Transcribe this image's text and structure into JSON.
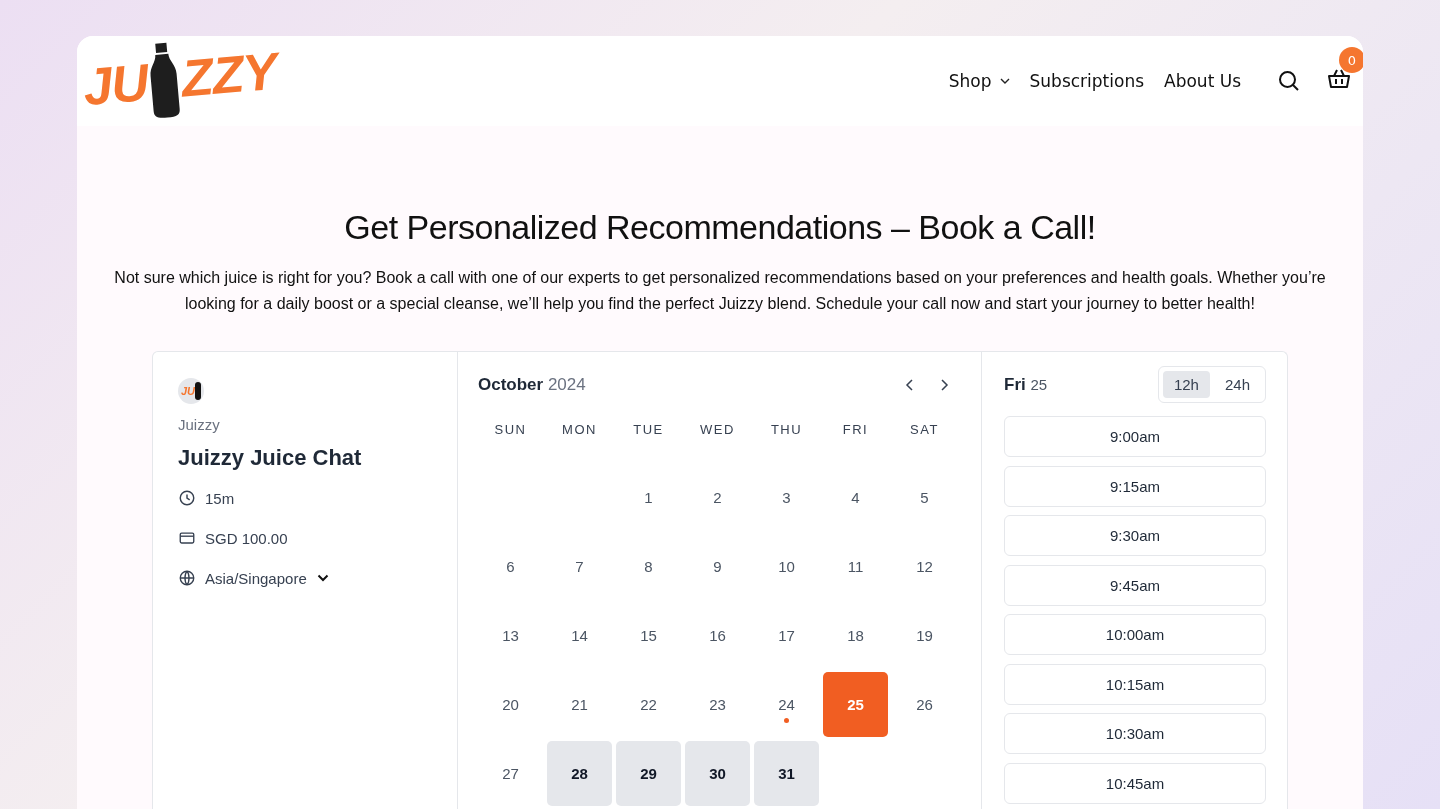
{
  "logo": {
    "left": "JU",
    "right": "ZZY"
  },
  "nav": [
    {
      "label": "Shop",
      "dropdown": true
    },
    {
      "label": "Subscriptions",
      "dropdown": false
    },
    {
      "label": "About Us",
      "dropdown": false
    }
  ],
  "cart": {
    "count": "0"
  },
  "heading": "Get Personalized Recommendations – Book a Call!",
  "intro": "Not sure which juice is right for you? Book a call with one of our experts to get personalized recommendations based on your preferences and health goals. Whether you’re looking for a daily boost or a special cleanse, we’ll help you find the perfect Juizzy blend. Schedule your call now and start your journey to better health!",
  "event": {
    "avatar": "JU",
    "host": "Juizzy",
    "title": "Juizzy Juice Chat",
    "duration": "15m",
    "price": "SGD 100.00",
    "timezone": "Asia/Singapore"
  },
  "calendar": {
    "month": "October",
    "year": "2024",
    "weekdays": [
      "SUN",
      "MON",
      "TUE",
      "WED",
      "THU",
      "FRI",
      "SAT"
    ],
    "days": [
      {
        "kind": "blank"
      },
      {
        "kind": "blank"
      },
      {
        "label": "1",
        "kind": "plain"
      },
      {
        "label": "2",
        "kind": "plain"
      },
      {
        "label": "3",
        "kind": "plain"
      },
      {
        "label": "4",
        "kind": "plain"
      },
      {
        "label": "5",
        "kind": "plain"
      },
      {
        "label": "6",
        "kind": "plain"
      },
      {
        "label": "7",
        "kind": "plain"
      },
      {
        "label": "8",
        "kind": "plain"
      },
      {
        "label": "9",
        "kind": "plain"
      },
      {
        "label": "10",
        "kind": "plain"
      },
      {
        "label": "11",
        "kind": "plain"
      },
      {
        "label": "12",
        "kind": "plain"
      },
      {
        "label": "13",
        "kind": "plain"
      },
      {
        "label": "14",
        "kind": "plain"
      },
      {
        "label": "15",
        "kind": "plain"
      },
      {
        "label": "16",
        "kind": "plain"
      },
      {
        "label": "17",
        "kind": "plain"
      },
      {
        "label": "18",
        "kind": "plain"
      },
      {
        "label": "19",
        "kind": "plain"
      },
      {
        "label": "20",
        "kind": "plain"
      },
      {
        "label": "21",
        "kind": "plain"
      },
      {
        "label": "22",
        "kind": "plain"
      },
      {
        "label": "23",
        "kind": "plain"
      },
      {
        "label": "24",
        "kind": "today"
      },
      {
        "label": "25",
        "kind": "selected"
      },
      {
        "label": "26",
        "kind": "plain"
      },
      {
        "label": "27",
        "kind": "plain"
      },
      {
        "label": "28",
        "kind": "available"
      },
      {
        "label": "29",
        "kind": "available"
      },
      {
        "label": "30",
        "kind": "available"
      },
      {
        "label": "31",
        "kind": "available"
      }
    ]
  },
  "slots_panel": {
    "weekday": "Fri",
    "date": "25",
    "formats": [
      {
        "label": "12h",
        "selected": true
      },
      {
        "label": "24h",
        "selected": false
      }
    ],
    "slots": [
      "9:00am",
      "9:15am",
      "9:30am",
      "9:45am",
      "10:00am",
      "10:15am",
      "10:30am",
      "10:45am"
    ]
  }
}
